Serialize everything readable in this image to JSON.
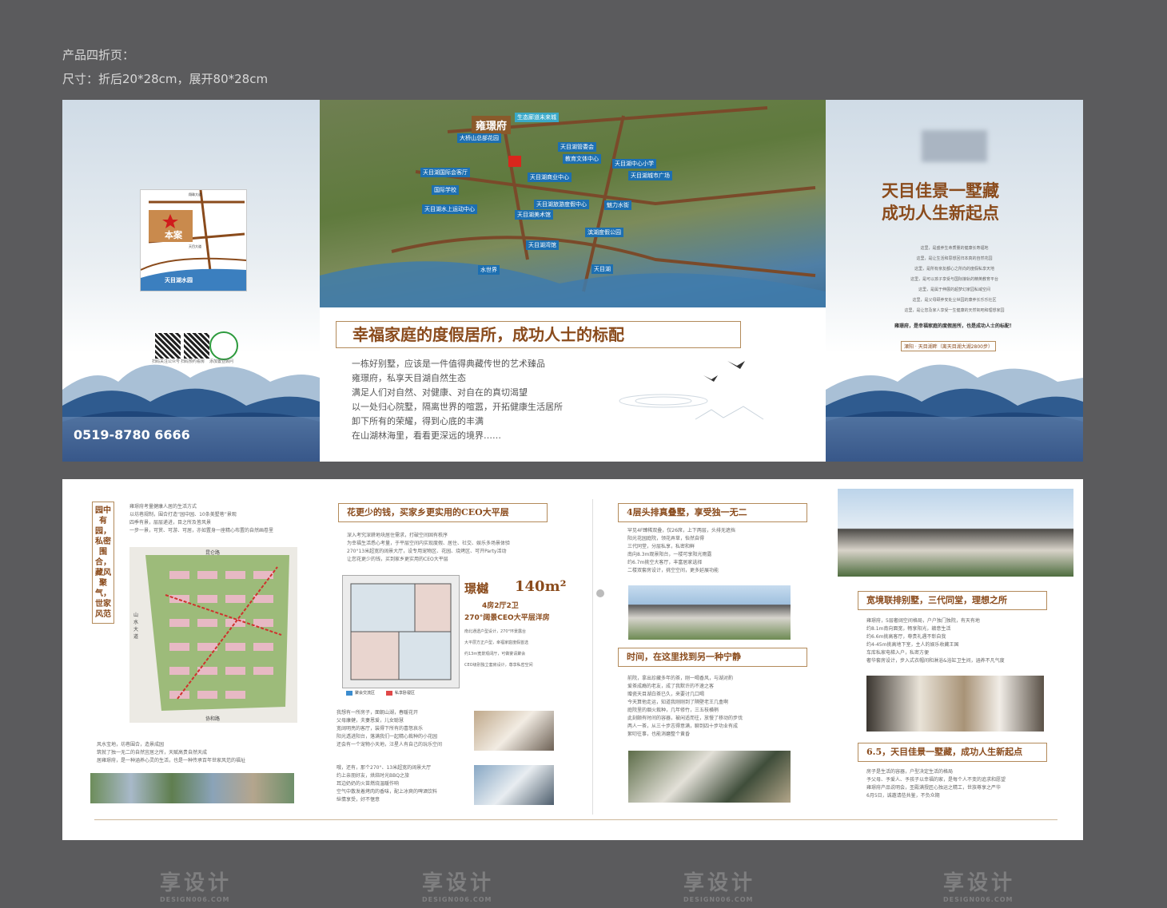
{
  "header": {
    "line1": "产品四折页：",
    "line2": "尺寸：折后20*28cm，展开80*28cm"
  },
  "watermark": {
    "text": "享设计",
    "sub": "DESIGN006.COM"
  },
  "panel1": {
    "map_labels": {
      "center": "本案",
      "road1": "翔珠大道",
      "road2": "天目大道",
      "park": "天目湖水园"
    },
    "qr_labels": [
      "扫码关注公众号",
      "扫码预约看房",
      "添加置业顾问"
    ],
    "phone": "0519-8780 6666"
  },
  "panel2": {
    "brand": "雍璟府",
    "map_tags": [
      "大桥山总部花园",
      "天目湖管委会",
      "教育文体中心",
      "天目湖国际会客厅",
      "天目湖中心小学",
      "天目湖商业中心",
      "天目湖城市广场",
      "国际学校",
      "天目湖水上运动中心",
      "天目湖旅游度假中心",
      "魅力水街",
      "天目湖美术馆",
      "滨湖度假公园",
      "天目湖湾馆",
      "水世界",
      "天目湖",
      "生态廊道未来城"
    ],
    "slogan": "幸福家庭的度假居所，成功人士的标配",
    "body": [
      "一栋好别墅，应该是一件值得典藏传世的艺术臻品",
      "雍璟府，私享天目湖自然生态",
      "满足人们对自然、对健康、对自在的真切渴望",
      "以一处归心院墅，隔离世界的喧嚣，开拓健康生活居所",
      "卸下所有的荣耀，得到心底的丰满",
      "在山湖林海里，看看更深远的境界……"
    ]
  },
  "panel3": {
    "title1": "天目佳景一墅藏",
    "title2": "成功人生新起点",
    "lines": [
      "这里，是盛养生命质量的健康长寿福地",
      "这里，是让生活和思想回归本真的自然花园",
      "这里，是所有亲友都心之所向的度假私享天地",
      "这里，是可以孩子享受与国际接轨的精英教育平台",
      "这里，是属于伸展的超梦幻家园私域空间",
      "这里，是父母颐养安处尘世园的康养长乐乐社区",
      "这里，是让您及家人享受一生健康的天然氧吧和理想家园"
    ],
    "tail": "雍璟府，是幸福家庭的度假居所，也是成功人士的标配！",
    "address": "溧阳 · 天目湖畔（离天目湖大湖2800步）"
  },
  "bottom": {
    "vtitle": "园中有园，私密围合，藏风聚气，世家风范",
    "intro": [
      "雍璟府考量健康人居的生活方式",
      "以坊巷规制，围合打造“园中园、10条美墅巷”景观",
      "四季有景，层层递进，目之所及皆风景",
      "一步一景，可赏、可游、可居，亦如置身一座精心布置的自然画卷里"
    ],
    "intro_bottom": [
      "风水宝地，坊巷围合，造景成园",
      "筑就了独一无二的自然宜居之所，天赋高贵自然天成",
      "居雍璟府，是一种涵养心灵的生活，也是一种传承百年世家风范的福址"
    ],
    "sec1": "花更少的钱，买家乡更实用的CEO大平层",
    "sec1_text": [
      "深入考究深耕地块居住需求，打破空间固有秩序",
      "为幸福生活悉心考量，于平层空间内实现度假、居住、社交、娱乐多场景体验",
      "270°13米超宽的阔景大厅，设专用宠物区、花园、烧烤区、可开Party活动",
      "让您花更少的钱，买到家乡更实用的CEO大平层"
    ],
    "unit_name": "璟樾",
    "unit_area": "140m²",
    "unit_layout": "4房2厅2卫",
    "unit_desc": "270°阔景CEO大平层洋房",
    "unit_points": [
      "南北通透户型设计，270°环景露台",
      "大平层方正户型，幸福家庭度假首选",
      "约13m宽景观阔厅，可做宴请聚会",
      "CEO级别独立套房设计，尊享私密空间"
    ],
    "unit_legend": [
      "聚会交流区",
      "私享卧寝区"
    ],
    "story1": [
      "我想有一所房子，面朝山湖，春暖花开",
      "父母康健，夫妻恩爱，儿女聪慧",
      "宽阔明亮的客厅，装得下所有的喜怒哀乐",
      "阳光透进阳台，落满我们一起精心栽种的小花园",
      "还会有一个宠物小天地，汪星人有自己的玩乐空间"
    ],
    "story2": [
      "哦，还有，那个270°、13米超宽的阔景大厅",
      "约上亲朋好友，烘焙时光BBQ之旅",
      "耳边奶奶的火苗燃烧温暖作响",
      "空气中散发着烤肉的香味，配上冰爽的啤酒饮料",
      "纵情享受，好不惬意"
    ],
    "sec2": "4层头排真叠墅，享受独一无二",
    "sec2_text": [
      "罕见4F臻稀双叠，仅26席，上下两层，头排无遮挡",
      "阳光花园庭院，领花弄草，怡然自得",
      "三代同堂，分层私享，私密和鲜",
      "南向8.3m观景阳台，一楼可享阳光雨露",
      "约6.7m挑空大客厅，丰富居家选择",
      "二楼双套房设计，挑空空间，更多延展功能"
    ],
    "sec3": "时间，在这里找到另一种宁静",
    "sec3_text": [
      "前院，拿出珍藏多年的茶，刚一喝香风，与湖对酌",
      "爱茶成瘾的老友，成了我默许的不速之客",
      "赠瓷天目湖白茶已久，来要讨几口喝",
      "今天算他走运，知道我刚刚到了隔壁老王几盒啊",
      "庭院里的烟火栽种，几年修竹，三五枝横梢",
      "此刻颇有时间的容器，被闲适而往，放慢了移动的步伐",
      "两人一茶，从三十步志得意满，聊到四十步功业有成",
      "絮叨往事，也能消磨整个黄昏"
    ],
    "sec4": "宽境联排别墅，三代同堂，理想之所",
    "sec4_text": [
      "雍璟府，5层奢阔空间格局，户户独门独院，有天有地",
      "约8.1m南向面宽，畅享阳光，赣意生活",
      "约6.6m挑高客厅，尊贵礼遇不彰自我",
      "约4-45m挑高地下室，主人的娱乐收藏王国",
      "车库私家电梯入户，私密方便",
      "奢华套房设计，步入式衣帽间和淋浴&浴缸卫生间，涵养不凡气度"
    ],
    "sec5": "6.5，天目佳景一墅藏，成功人生新起点",
    "sec5_text": [
      "房子是生活的容器，户型决定生活的格局",
      "予父母、予爱人、予孩子以幸福的家，是每个人不变的追求和愿望",
      "雍璟府产品说明会，圣殿满授匠心独运之精工，世族尊享之严华",
      "6月5日，诚邀请莅共鉴，不负众期"
    ],
    "site_roads": [
      "昆仑路",
      "协和路",
      "山水大道"
    ]
  },
  "colors": {
    "brown": "#8a4b1c",
    "gold": "#b38a5a",
    "blue_tag": "#1d6fb1",
    "bg": "#5b5b5d"
  }
}
